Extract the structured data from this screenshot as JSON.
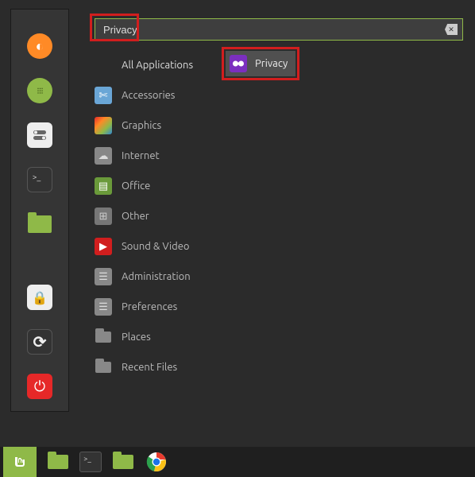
{
  "search": {
    "value": "Privacy",
    "clear_glyph": "⌫"
  },
  "categories": [
    {
      "label": "All Applications",
      "icon": "",
      "kind": "none"
    },
    {
      "label": "Accessories",
      "icon": "✄",
      "kind": "scissors"
    },
    {
      "label": "Graphics",
      "icon": "▦",
      "kind": "graphics"
    },
    {
      "label": "Internet",
      "icon": "☁",
      "kind": "cloud"
    },
    {
      "label": "Office",
      "icon": "▤",
      "kind": "office"
    },
    {
      "label": "Other",
      "icon": "⊞",
      "kind": "grid"
    },
    {
      "label": "Sound & Video",
      "icon": "▶",
      "kind": "play"
    },
    {
      "label": "Administration",
      "icon": "☰",
      "kind": "admin"
    },
    {
      "label": "Preferences",
      "icon": "☰",
      "kind": "prefs"
    },
    {
      "label": "Places",
      "icon": "",
      "kind": "folder"
    },
    {
      "label": "Recent Files",
      "icon": "",
      "kind": "folder"
    }
  ],
  "results": [
    {
      "label": "Privacy",
      "icon": "∞",
      "kind": "privacy"
    }
  ],
  "favorites": [
    {
      "name": "firefox",
      "bg": "#ff8a26",
      "glyph": "◐"
    },
    {
      "name": "apps",
      "bg": "#8fb948",
      "glyph": "⁝⁝⁝"
    },
    {
      "name": "toggles",
      "bg": "#eee",
      "glyph": "⫞"
    },
    {
      "name": "terminal",
      "bg": "#333",
      "glyph": ">_"
    },
    {
      "name": "files-open",
      "bg": "#8fb948",
      "glyph": ""
    },
    {
      "name": "lock",
      "bg": "#eee",
      "glyph": "🔒"
    },
    {
      "name": "restart",
      "bg": "#333",
      "glyph": "⟳"
    },
    {
      "name": "power",
      "bg": "#e62828",
      "glyph": "⏻"
    }
  ],
  "taskbar": [
    {
      "name": "menu",
      "kind": "mint"
    },
    {
      "name": "files",
      "kind": "folder-green-active"
    },
    {
      "name": "terminal",
      "kind": "terminal"
    },
    {
      "name": "files-2",
      "kind": "folder-green"
    },
    {
      "name": "chrome",
      "kind": "chrome"
    }
  ]
}
